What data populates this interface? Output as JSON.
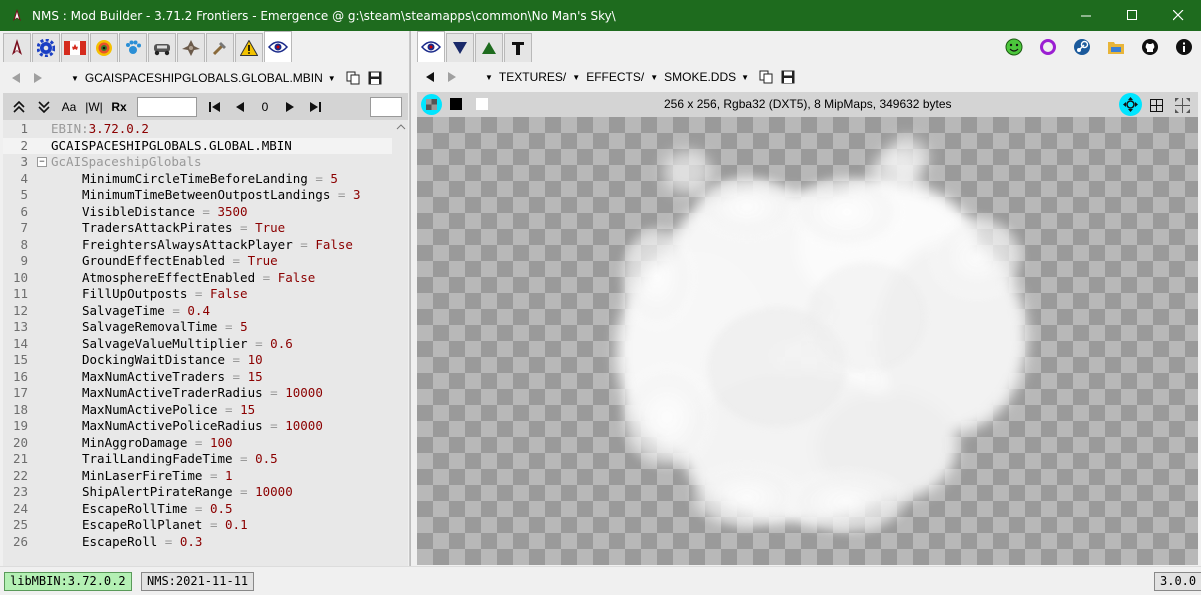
{
  "window": {
    "title": "NMS : Mod Builder - 3.71.2 Frontiers - Emergence @ g:\\steam\\steamapps\\common\\No Man's Sky\\"
  },
  "left": {
    "path": {
      "file": "GCAISPACESHIPGLOBALS.GLOBAL.MBIN"
    },
    "search": {
      "case_label": "Aa",
      "word_label": "|W|",
      "regex_label": "Rx",
      "match_count": "0"
    },
    "lines": [
      {
        "n": "1",
        "key": "EBIN:",
        "val": "3.72.0.2",
        "kind": "header"
      },
      {
        "n": "2",
        "key": "GCAISPACESHIPGLOBALS.GLOBAL.MBIN",
        "val": "",
        "kind": "plain"
      },
      {
        "n": "3",
        "key": "GcAISpaceshipGlobals",
        "val": "",
        "kind": "section"
      },
      {
        "n": "4",
        "key": "MinimumCircleTimeBeforeLanding",
        "val": "5",
        "kind": "prop"
      },
      {
        "n": "5",
        "key": "MinimumTimeBetweenOutpostLandings",
        "val": "3",
        "kind": "prop"
      },
      {
        "n": "6",
        "key": "VisibleDistance",
        "val": "3500",
        "kind": "prop"
      },
      {
        "n": "7",
        "key": "TradersAttackPirates",
        "val": "True",
        "kind": "prop"
      },
      {
        "n": "8",
        "key": "FreightersAlwaysAttackPlayer",
        "val": "False",
        "kind": "prop"
      },
      {
        "n": "9",
        "key": "GroundEffectEnabled",
        "val": "True",
        "kind": "prop"
      },
      {
        "n": "10",
        "key": "AtmosphereEffectEnabled",
        "val": "False",
        "kind": "prop"
      },
      {
        "n": "11",
        "key": "FillUpOutposts",
        "val": "False",
        "kind": "prop"
      },
      {
        "n": "12",
        "key": "SalvageTime",
        "val": "0.4",
        "kind": "prop"
      },
      {
        "n": "13",
        "key": "SalvageRemovalTime",
        "val": "5",
        "kind": "prop"
      },
      {
        "n": "14",
        "key": "SalvageValueMultiplier",
        "val": "0.6",
        "kind": "prop"
      },
      {
        "n": "15",
        "key": "DockingWaitDistance",
        "val": "10",
        "kind": "prop"
      },
      {
        "n": "16",
        "key": "MaxNumActiveTraders",
        "val": "15",
        "kind": "prop"
      },
      {
        "n": "17",
        "key": "MaxNumActiveTraderRadius",
        "val": "10000",
        "kind": "prop"
      },
      {
        "n": "18",
        "key": "MaxNumActivePolice",
        "val": "15",
        "kind": "prop"
      },
      {
        "n": "19",
        "key": "MaxNumActivePoliceRadius",
        "val": "10000",
        "kind": "prop"
      },
      {
        "n": "20",
        "key": "MinAggroDamage",
        "val": "100",
        "kind": "prop"
      },
      {
        "n": "21",
        "key": "TrailLandingFadeTime",
        "val": "0.5",
        "kind": "prop"
      },
      {
        "n": "22",
        "key": "MinLaserFireTime",
        "val": "1",
        "kind": "prop"
      },
      {
        "n": "23",
        "key": "ShipAlertPirateRange",
        "val": "10000",
        "kind": "prop"
      },
      {
        "n": "24",
        "key": "EscapeRollTime",
        "val": "0.5",
        "kind": "prop"
      },
      {
        "n": "25",
        "key": "EscapeRollPlanet",
        "val": "0.1",
        "kind": "prop"
      },
      {
        "n": "26",
        "key": "EscapeRoll",
        "val": "0.3",
        "kind": "prop"
      }
    ],
    "eq": "="
  },
  "right": {
    "path": {
      "seg1": "TEXTURES/",
      "seg2": "EFFECTS/",
      "seg3": "SMOKE.DDS"
    },
    "info": "256 x 256,  Rgba32 (DXT5),  8 MipMaps,  349632 bytes"
  },
  "status": {
    "libmbin": "libMBIN:3.72.0.2",
    "nms": "NMS:2021-11-11",
    "version": "3.0.0"
  },
  "colors": {
    "titlebar": "#1e6b1e",
    "libmbin_badge": "#b4f0b4",
    "value": "#8b0000",
    "highlight": "#00e5ff"
  }
}
